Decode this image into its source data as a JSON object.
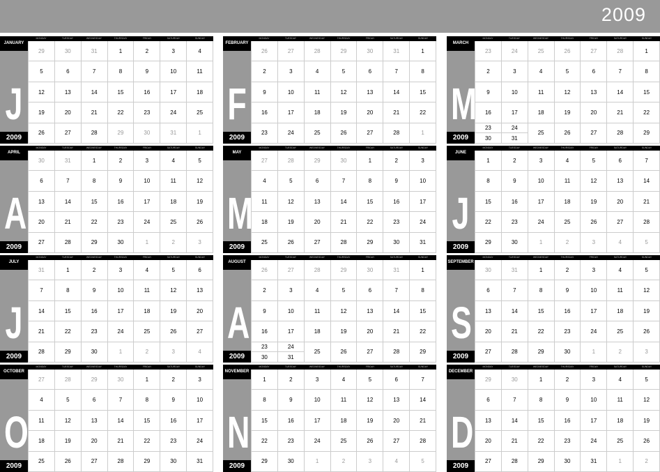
{
  "year": "2009",
  "day_headers": [
    "MONDAY",
    "TUESDAY",
    "WEDNESDAY",
    "THURSDAY",
    "FRIDAY",
    "SATURDAY",
    "SUNDAY"
  ],
  "months": [
    {
      "name": "JANUARY",
      "letter": "J",
      "year": "2009",
      "weeks": [
        [
          "29",
          "30",
          "31",
          "1",
          "2",
          "3",
          "4"
        ],
        [
          "5",
          "6",
          "7",
          "8",
          "9",
          "10",
          "11"
        ],
        [
          "12",
          "13",
          "14",
          "15",
          "16",
          "17",
          "18"
        ],
        [
          "19",
          "20",
          "21",
          "22",
          "23",
          "24",
          "25"
        ],
        [
          "26",
          "27",
          "28",
          "29",
          "30",
          "31",
          "1"
        ]
      ],
      "first": 3,
      "last": 30
    },
    {
      "name": "FEBRUARY",
      "letter": "F",
      "year": "2009",
      "weeks": [
        [
          "26",
          "27",
          "28",
          "29",
          "30",
          "31",
          "1"
        ],
        [
          "2",
          "3",
          "4",
          "5",
          "6",
          "7",
          "8"
        ],
        [
          "9",
          "10",
          "11",
          "12",
          "13",
          "14",
          "15"
        ],
        [
          "16",
          "17",
          "18",
          "19",
          "20",
          "21",
          "22"
        ],
        [
          "23",
          "24",
          "25",
          "26",
          "27",
          "28",
          "1"
        ]
      ],
      "first": 6,
      "last": 33
    },
    {
      "name": "MARCH",
      "letter": "M",
      "year": "2009",
      "weeks": [
        [
          "23",
          "24",
          "25",
          "26",
          "27",
          "28",
          "1"
        ],
        [
          "2",
          "3",
          "4",
          "5",
          "6",
          "7",
          "8"
        ],
        [
          "9",
          "10",
          "11",
          "12",
          "13",
          "14",
          "15"
        ],
        [
          "16",
          "17",
          "18",
          "19",
          "20",
          "21",
          "22"
        ],
        [
          "23/30",
          "24/31",
          "25",
          "26",
          "27",
          "28",
          "29"
        ]
      ],
      "first": 6,
      "last": 34
    },
    {
      "name": "APRIL",
      "letter": "A",
      "year": "2009",
      "weeks": [
        [
          "30",
          "31",
          "1",
          "2",
          "3",
          "4",
          "5"
        ],
        [
          "6",
          "7",
          "8",
          "9",
          "10",
          "11",
          "12"
        ],
        [
          "13",
          "14",
          "15",
          "16",
          "17",
          "18",
          "19"
        ],
        [
          "20",
          "21",
          "22",
          "23",
          "24",
          "25",
          "26"
        ],
        [
          "27",
          "28",
          "29",
          "30",
          "1",
          "2",
          "3"
        ]
      ],
      "first": 2,
      "last": 31
    },
    {
      "name": "MAY",
      "letter": "M",
      "year": "2009",
      "weeks": [
        [
          "27",
          "28",
          "29",
          "30",
          "1",
          "2",
          "3"
        ],
        [
          "4",
          "5",
          "6",
          "7",
          "8",
          "9",
          "10"
        ],
        [
          "11",
          "12",
          "13",
          "14",
          "15",
          "16",
          "17"
        ],
        [
          "18",
          "19",
          "20",
          "21",
          "22",
          "23",
          "24"
        ],
        [
          "25",
          "26",
          "27",
          "28",
          "29",
          "30",
          "31"
        ]
      ],
      "first": 4,
      "last": 34
    },
    {
      "name": "JUNE",
      "letter": "J",
      "year": "2009",
      "weeks": [
        [
          "1",
          "2",
          "3",
          "4",
          "5",
          "6",
          "7"
        ],
        [
          "8",
          "9",
          "10",
          "11",
          "12",
          "13",
          "14"
        ],
        [
          "15",
          "16",
          "17",
          "18",
          "19",
          "20",
          "21"
        ],
        [
          "22",
          "23",
          "24",
          "25",
          "26",
          "27",
          "28"
        ],
        [
          "29",
          "30",
          "1",
          "2",
          "3",
          "4",
          "5"
        ]
      ],
      "first": 0,
      "last": 29
    },
    {
      "name": "JULY",
      "letter": "J",
      "year": "2009",
      "weeks": [
        [
          "31",
          "1",
          "2",
          "3",
          "4",
          "5",
          "6"
        ],
        [
          "7",
          "8",
          "9",
          "10",
          "11",
          "12",
          "13"
        ],
        [
          "14",
          "15",
          "16",
          "17",
          "18",
          "19",
          "20"
        ],
        [
          "21",
          "22",
          "23",
          "24",
          "25",
          "26",
          "27"
        ],
        [
          "28",
          "29",
          "30",
          "1",
          "2",
          "3",
          "4"
        ]
      ],
      "first": 1,
      "last": 30
    },
    {
      "name": "AUGUST",
      "letter": "A",
      "year": "2009",
      "weeks": [
        [
          "26",
          "27",
          "28",
          "29",
          "30",
          "31",
          "1"
        ],
        [
          "2",
          "3",
          "4",
          "5",
          "6",
          "7",
          "8"
        ],
        [
          "9",
          "10",
          "11",
          "12",
          "13",
          "14",
          "15"
        ],
        [
          "16",
          "17",
          "18",
          "19",
          "20",
          "21",
          "22"
        ],
        [
          "23/30",
          "24/31",
          "25",
          "26",
          "27",
          "28",
          "29"
        ]
      ],
      "first": 6,
      "last": 34
    },
    {
      "name": "SEPTEMBER",
      "letter": "S",
      "year": "2009",
      "weeks": [
        [
          "30",
          "31",
          "1",
          "2",
          "3",
          "4",
          "5"
        ],
        [
          "6",
          "7",
          "8",
          "9",
          "10",
          "11",
          "12"
        ],
        [
          "13",
          "14",
          "15",
          "16",
          "17",
          "18",
          "19"
        ],
        [
          "20",
          "21",
          "22",
          "23",
          "24",
          "25",
          "26"
        ],
        [
          "27",
          "28",
          "29",
          "30",
          "1",
          "2",
          "3"
        ]
      ],
      "first": 2,
      "last": 31
    },
    {
      "name": "OCTOBER",
      "letter": "O",
      "year": "2009",
      "weeks": [
        [
          "27",
          "28",
          "29",
          "30",
          "1",
          "2",
          "3"
        ],
        [
          "4",
          "5",
          "6",
          "7",
          "8",
          "9",
          "10"
        ],
        [
          "11",
          "12",
          "13",
          "14",
          "15",
          "16",
          "17"
        ],
        [
          "18",
          "19",
          "20",
          "21",
          "22",
          "23",
          "24"
        ],
        [
          "25",
          "26",
          "27",
          "28",
          "29",
          "30",
          "31"
        ]
      ],
      "first": 4,
      "last": 34
    },
    {
      "name": "NOVEMBER",
      "letter": "N",
      "year": "2009",
      "weeks": [
        [
          "1",
          "2",
          "3",
          "4",
          "5",
          "6",
          "7"
        ],
        [
          "8",
          "9",
          "10",
          "11",
          "12",
          "13",
          "14"
        ],
        [
          "15",
          "16",
          "17",
          "18",
          "19",
          "20",
          "21"
        ],
        [
          "22",
          "23",
          "24",
          "25",
          "26",
          "27",
          "28"
        ],
        [
          "29",
          "30",
          "1",
          "2",
          "3",
          "4",
          "5"
        ]
      ],
      "first": 0,
      "last": 29
    },
    {
      "name": "DECEMBER",
      "letter": "D",
      "year": "2009",
      "weeks": [
        [
          "29",
          "30",
          "1",
          "2",
          "3",
          "4",
          "5"
        ],
        [
          "6",
          "7",
          "8",
          "9",
          "10",
          "11",
          "12"
        ],
        [
          "13",
          "14",
          "15",
          "16",
          "17",
          "18",
          "19"
        ],
        [
          "20",
          "21",
          "22",
          "23",
          "24",
          "25",
          "26"
        ],
        [
          "27",
          "28",
          "29",
          "30",
          "31",
          "1",
          "2"
        ]
      ],
      "first": 2,
      "last": 32
    }
  ]
}
